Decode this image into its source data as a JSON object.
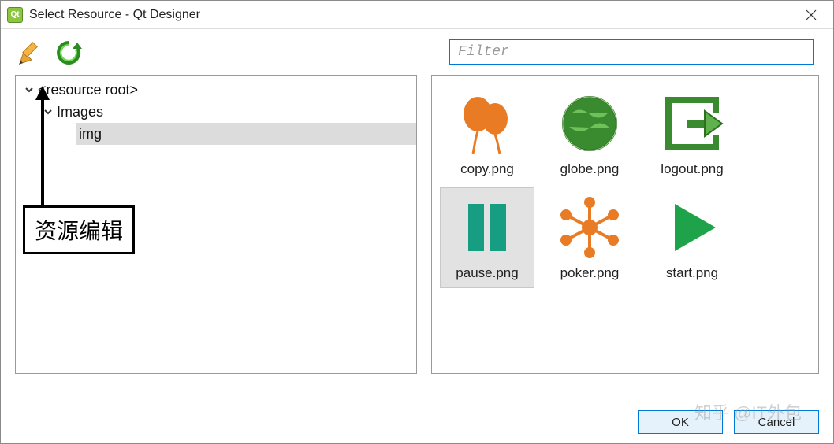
{
  "window": {
    "title": "Select Resource - Qt Designer",
    "app_icon_label": "Qt"
  },
  "filter": {
    "placeholder": "Filter",
    "value": ""
  },
  "tree": {
    "root_label": "<resource root>",
    "group_label": "Images",
    "item_label": "img"
  },
  "grid": {
    "items": [
      {
        "name": "copy.png",
        "icon": "balloons"
      },
      {
        "name": "globe.png",
        "icon": "globe"
      },
      {
        "name": "logout.png",
        "icon": "logout"
      },
      {
        "name": "pause.png",
        "icon": "pause",
        "selected": true
      },
      {
        "name": "poker.png",
        "icon": "poker"
      },
      {
        "name": "start.png",
        "icon": "play"
      }
    ]
  },
  "buttons": {
    "ok": "OK",
    "cancel": "Cancel"
  },
  "annotation": {
    "label": "资源编辑"
  },
  "watermark": "知乎 @IT外包"
}
